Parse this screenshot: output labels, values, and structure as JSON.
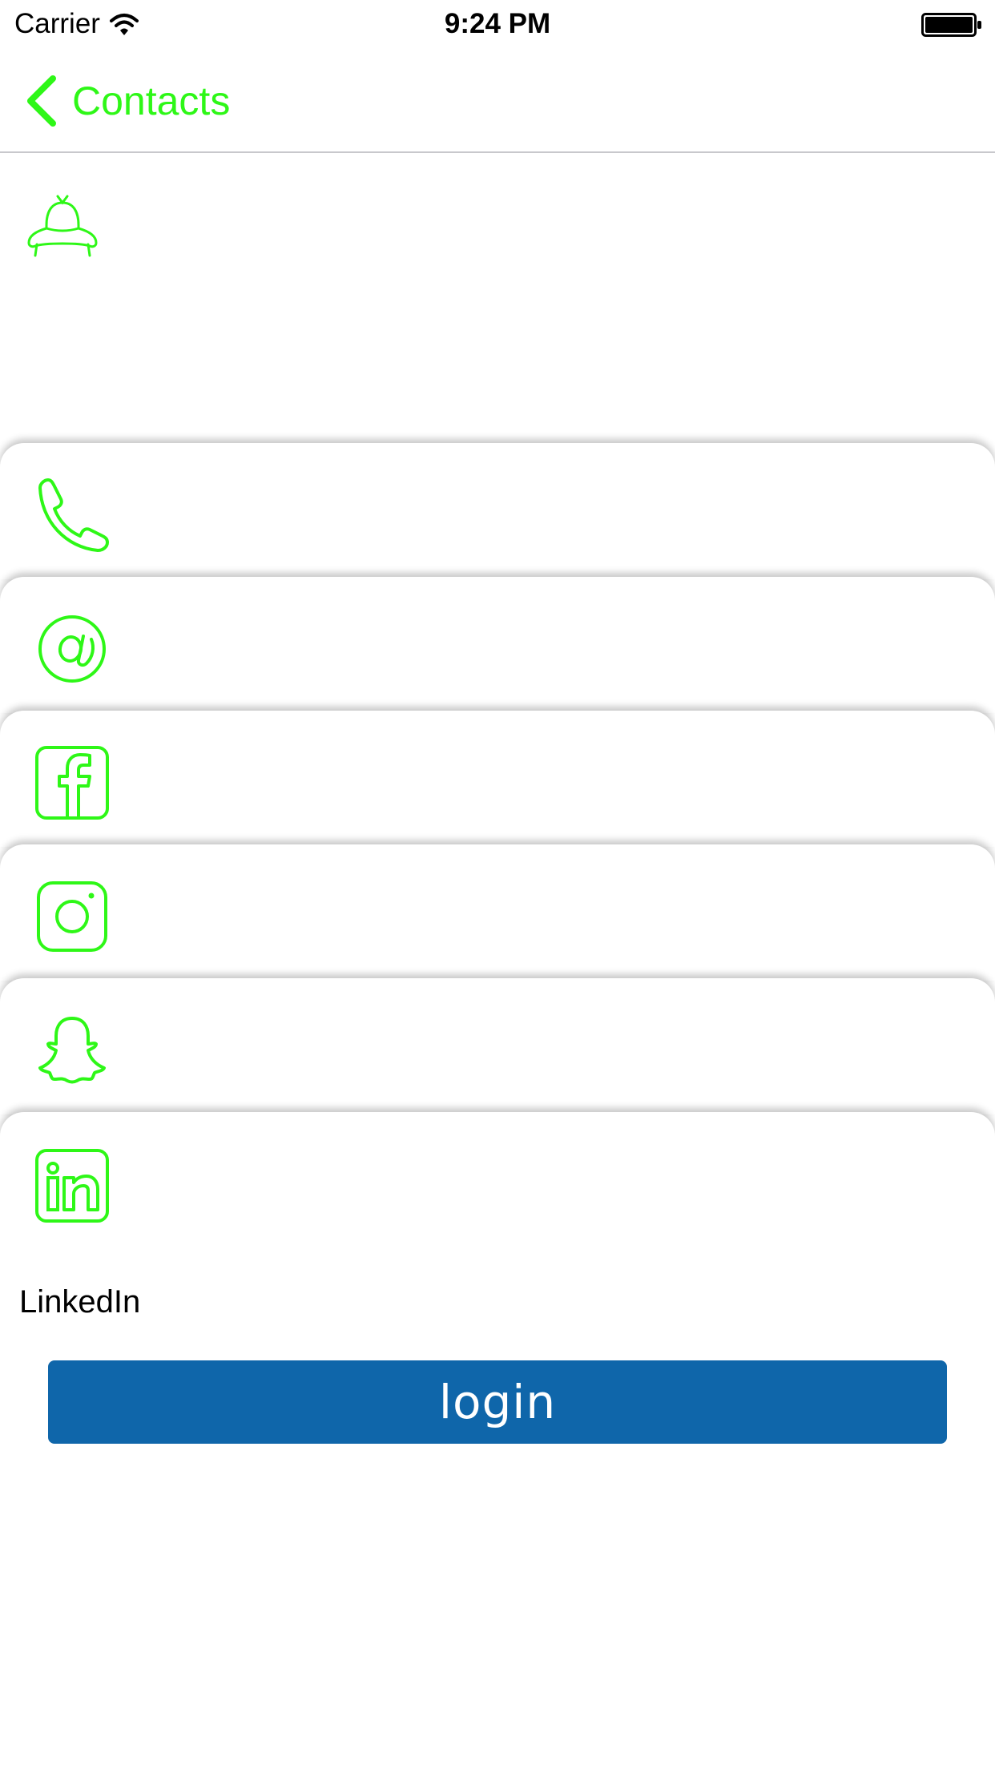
{
  "status_bar": {
    "carrier": "Carrier",
    "time": "9:24 PM"
  },
  "nav": {
    "back_label": "Contacts"
  },
  "theme": {
    "accent": "#2ef717",
    "button_bg": "#0f66aa",
    "button_text": "#ffffff"
  },
  "cards": [
    {
      "icon": "ufo-icon"
    },
    {
      "icon": "phone-icon"
    },
    {
      "icon": "email-at-icon"
    },
    {
      "icon": "facebook-icon"
    },
    {
      "icon": "instagram-icon"
    },
    {
      "icon": "snapchat-icon"
    },
    {
      "icon": "linkedin-icon"
    }
  ],
  "linkedin": {
    "label": "LinkedIn"
  },
  "login": {
    "label": "login"
  }
}
